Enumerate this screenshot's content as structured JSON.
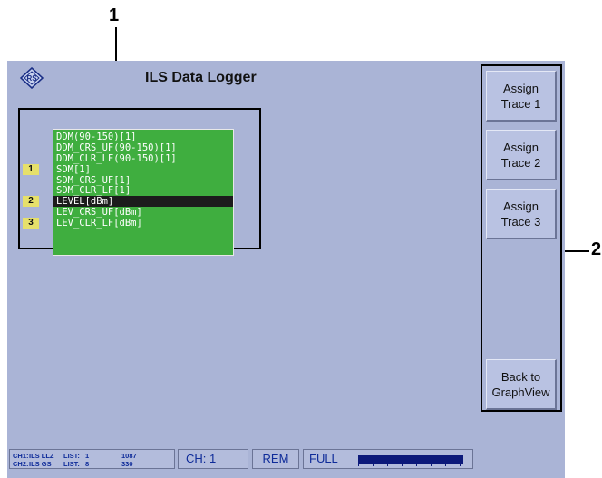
{
  "callouts": {
    "frame": "1",
    "softkeys": "2"
  },
  "header": {
    "title": "ILS Data Logger",
    "logo": "rohde-schwarz-logo"
  },
  "trace_list": {
    "items": [
      "DDM(90-150)[1]",
      "DDM_CRS_UF(90-150)[1]",
      "DDM_CLR_LF(90-150)[1]",
      "SDM[1]",
      "SDM_CRS_UF[1]",
      "SDM_CLR_LF[1]",
      "LEVEL[dBm]",
      "LEV_CRS_UF[dBm]",
      "LEV_CLR_LF[dBm]"
    ],
    "selected_index": 6,
    "markers": [
      {
        "label": "1",
        "row": 3
      },
      {
        "label": "2",
        "row": 6
      },
      {
        "label": "3",
        "row": 8
      }
    ]
  },
  "softkeys": {
    "assign_trace_1": "Assign Trace 1",
    "assign_trace_2": "Assign Trace 2",
    "assign_trace_3": "Assign Trace 3",
    "back_to_graphview": "Back to GraphView"
  },
  "status_bar": {
    "ch1": {
      "label": "CH1:",
      "mode": "ILS LLZ",
      "list_label": "LIST:",
      "list": "1",
      "count": "1087"
    },
    "ch2": {
      "label": "CH2:",
      "mode": "ILS GS",
      "list_label": "LIST:",
      "list": "8",
      "count": "330"
    },
    "ch_label": "CH:",
    "ch_value": "1",
    "rem": "REM",
    "full": "FULL",
    "level_fraction": 1.0
  },
  "colors": {
    "screen_bg": "#aab4d6",
    "list_bg": "#3fae3f",
    "selected_row_bg": "#1c1c1c",
    "marker_bg": "#e6e06a",
    "status_text": "#0e2b99"
  }
}
